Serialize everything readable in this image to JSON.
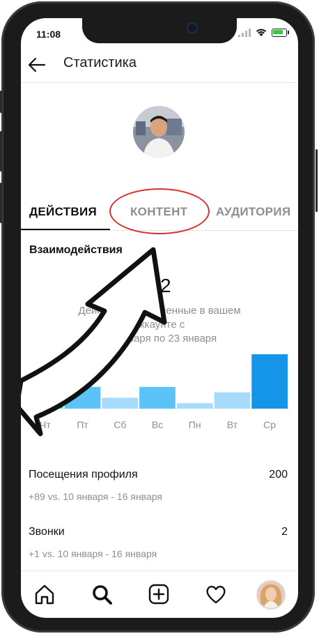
{
  "status": {
    "time": "11:08"
  },
  "header": {
    "title": "Статистика"
  },
  "tabs": [
    {
      "label": "ДЕЙСТВИЯ"
    },
    {
      "label": "КОНТЕНТ"
    },
    {
      "label": "АУДИТОРИЯ"
    }
  ],
  "interactions": {
    "title": "Взаимодействия",
    "count": "2",
    "description_line1": "Действия, выполненные в вашем",
    "description_line2": "аккаунте с",
    "description_line3": "17 января по 23 января"
  },
  "chart_data": {
    "type": "bar",
    "categories": [
      "Чт",
      "Пт",
      "Сб",
      "Вс",
      "Пн",
      "Вт",
      "Ср"
    ],
    "values": [
      5,
      4,
      2,
      4,
      1,
      3,
      10
    ],
    "colors": [
      "#5bc3f7",
      "#5bc3f7",
      "#a6dcfb",
      "#5bc3f7",
      "#a6dcfb",
      "#a6dcfb",
      "#1595e8"
    ]
  },
  "stats": [
    {
      "title": "Посещения профиля",
      "value": "200",
      "sub": "+89 vs. 10 января - 16 января"
    },
    {
      "title": "Звонки",
      "value": "2",
      "sub": "+1 vs. 10 января - 16 января"
    }
  ],
  "nav": [
    "home-icon",
    "search-icon",
    "add-post-icon",
    "heart-icon",
    "profile-avatar"
  ]
}
